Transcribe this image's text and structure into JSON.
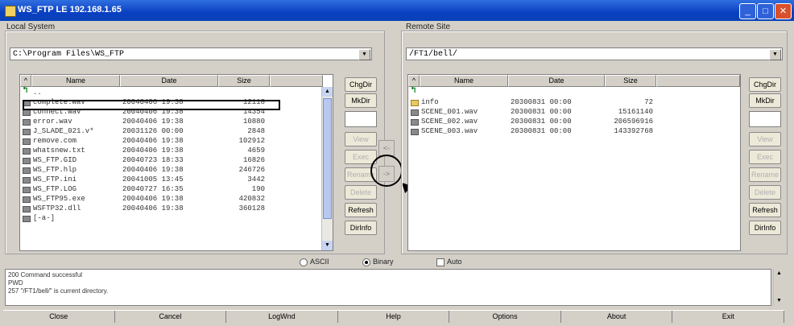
{
  "window": {
    "title": "WS_FTP LE 192.168.1.65"
  },
  "local": {
    "label": "Local System",
    "path": "C:\\Program Files\\WS_FTP",
    "columns": [
      "^",
      "Name",
      "Date",
      "Size"
    ],
    "rows": [
      {
        "name": "..",
        "date": "",
        "size": "",
        "icon": "up"
      },
      {
        "name": "complete.wav",
        "date": "20040406 19:38",
        "size": "12118",
        "icon": "file"
      },
      {
        "name": "connect.wav",
        "date": "20040406 19:38",
        "size": "14354",
        "icon": "file"
      },
      {
        "name": "error.wav",
        "date": "20040406 19:38",
        "size": "10880",
        "icon": "file"
      },
      {
        "name": "J_SLADE_021.v*",
        "date": "20031126 00:00",
        "size": "2848",
        "icon": "file"
      },
      {
        "name": "remove.com",
        "date": "20040406 19:38",
        "size": "102912",
        "icon": "file"
      },
      {
        "name": "whatsnew.txt",
        "date": "20040406 19:38",
        "size": "4659",
        "icon": "file"
      },
      {
        "name": "WS_FTP.GID",
        "date": "20040723 18:33",
        "size": "16826",
        "icon": "file"
      },
      {
        "name": "WS_FTP.hlp",
        "date": "20040406 19:38",
        "size": "246726",
        "icon": "file"
      },
      {
        "name": "WS_FTP.ini",
        "date": "20041005 13:45",
        "size": "3442",
        "icon": "file"
      },
      {
        "name": "WS_FTP.LOG",
        "date": "20040727 16:35",
        "size": "190",
        "icon": "file"
      },
      {
        "name": "WS_FTP95.exe",
        "date": "20040406 19:38",
        "size": "420832",
        "icon": "file"
      },
      {
        "name": "WSFTP32.dll",
        "date": "20040406 19:38",
        "size": "360128",
        "icon": "file"
      },
      {
        "name": "[-a-]",
        "date": "",
        "size": "",
        "icon": "drive"
      }
    ],
    "buttons": [
      "ChgDir",
      "MkDir",
      "View",
      "Exec",
      "Rename",
      "Delete",
      "Refresh",
      "DirInfo"
    ]
  },
  "remote": {
    "label": "Remote Site",
    "path": "/FT1/bell/",
    "columns": [
      "^",
      "Name",
      "Date",
      "Size"
    ],
    "rows": [
      {
        "name": "",
        "date": "",
        "size": "",
        "icon": "up"
      },
      {
        "name": "info",
        "date": "20300831 00:00",
        "size": "72",
        "icon": "folder"
      },
      {
        "name": "SCENE_001.wav",
        "date": "20300831 00:00",
        "size": "15161140",
        "icon": "file"
      },
      {
        "name": "SCENE_002.wav",
        "date": "20300831 00:00",
        "size": "206596916",
        "icon": "file"
      },
      {
        "name": "SCENE_003.wav",
        "date": "20300831 00:00",
        "size": "143392768",
        "icon": "file"
      }
    ],
    "buttons": [
      "ChgDir",
      "MkDir",
      "View",
      "Exec",
      "Rename",
      "Delete",
      "Refresh",
      "DirInfo"
    ]
  },
  "transfer": {
    "left": "<-",
    "right": "->"
  },
  "mode": {
    "ascii": "ASCII",
    "binary": "Binary",
    "auto": "Auto",
    "selected": "binary"
  },
  "log": [
    "200 Command successful",
    "PWD",
    "257 \"/FT1/bell/\" is current directory."
  ],
  "bottom_buttons": [
    "Close",
    "Cancel",
    "LogWnd",
    "Help",
    "Options",
    "About",
    "Exit"
  ],
  "colors": {
    "titlebar": "#0a3fc2",
    "highlight_box": "#000000"
  }
}
